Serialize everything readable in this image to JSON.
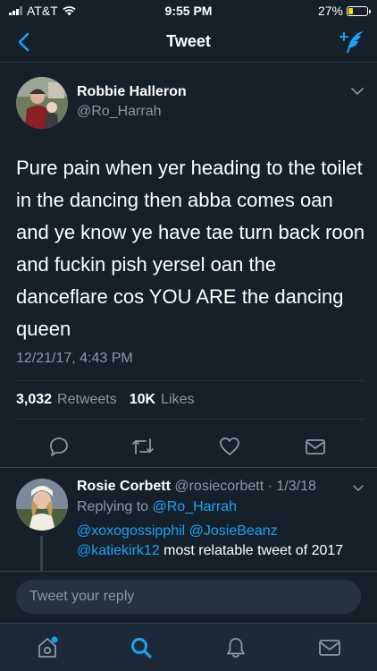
{
  "status_bar": {
    "carrier": "AT&T",
    "time": "9:55 PM",
    "battery": "27%",
    "battery_level": 0.27
  },
  "nav": {
    "title": "Tweet",
    "back_icon": "chevron-left-icon",
    "compose_icon": "compose-tweet-icon"
  },
  "tweet": {
    "author_name": "Robbie Halleron",
    "author_handle": "@Ro_Harrah",
    "text": "Pure pain when yer heading to the toilet in the dancing then abba comes oan and ye know ye have tae turn back roon and fuckin pish yersel oan the danceflare cos YOU ARE the dancing queen",
    "timestamp": "12/21/17, 4:43 PM",
    "retweets_count": "3,032",
    "retweets_label": "Retweets",
    "likes_count": "10K",
    "likes_label": "Likes"
  },
  "reply": {
    "author_name": "Rosie Corbett",
    "author_handle": "@rosiecorbett",
    "date": "· 1/3/18",
    "replying_label": "Replying to",
    "replying_to": "@Ro_Harrah",
    "mention_1": "@xoxogossipphil",
    "mention_2": "@JosieBeanz",
    "mention_3": "@katiekirk12",
    "text_suffix": "most relatable tweet of 2017"
  },
  "composer": {
    "placeholder": "Tweet your reply"
  },
  "colors": {
    "background": "#15202b",
    "accent": "#1da1f2",
    "secondary_text": "#8899a6",
    "battery": "#ffd400"
  }
}
